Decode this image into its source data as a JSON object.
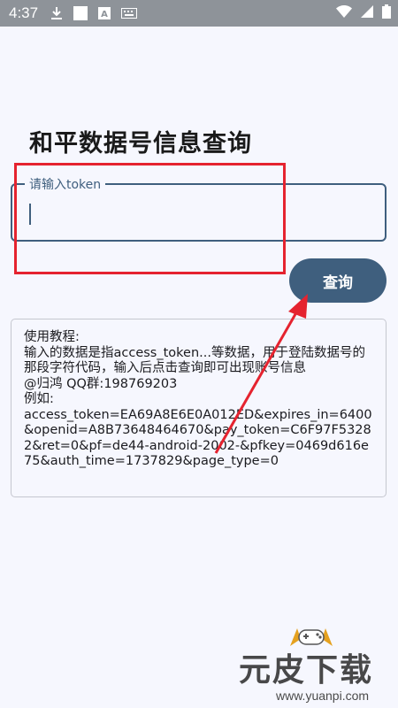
{
  "status_bar": {
    "time": "4:37",
    "icons": [
      "download-icon",
      "square-icon",
      "a-badge-icon",
      "keyboard-icon",
      "wifi-icon",
      "signal-icon",
      "battery-icon"
    ]
  },
  "page": {
    "title": "和平数据号信息查询"
  },
  "token_input": {
    "label": "请输入token",
    "value": ""
  },
  "query_button": {
    "label": "查询"
  },
  "tutorial": {
    "lines": [
      "使用教程:",
      "输入的数据是指access_token...等数据，用于登陆数据号的那段字符代码，输入后点击查询即可出现账号信息",
      "@归鸿  QQ群:198769203",
      "例如:",
      "access_token=EA69A8E6E0A012ED&expires_in=6400&openid=A8B73648464670&pay_token=C6F97F53282&ret=0&pf=de44-android-2002-&pfkey=0469d616e75&auth_time=1737829&page_type=0"
    ]
  },
  "watermark": {
    "title": "元皮下载",
    "url": "www.yuanpi.com"
  },
  "colors": {
    "accent": "#3f5f7e",
    "annotation": "#e5232f",
    "background": "#f6f7fe"
  }
}
